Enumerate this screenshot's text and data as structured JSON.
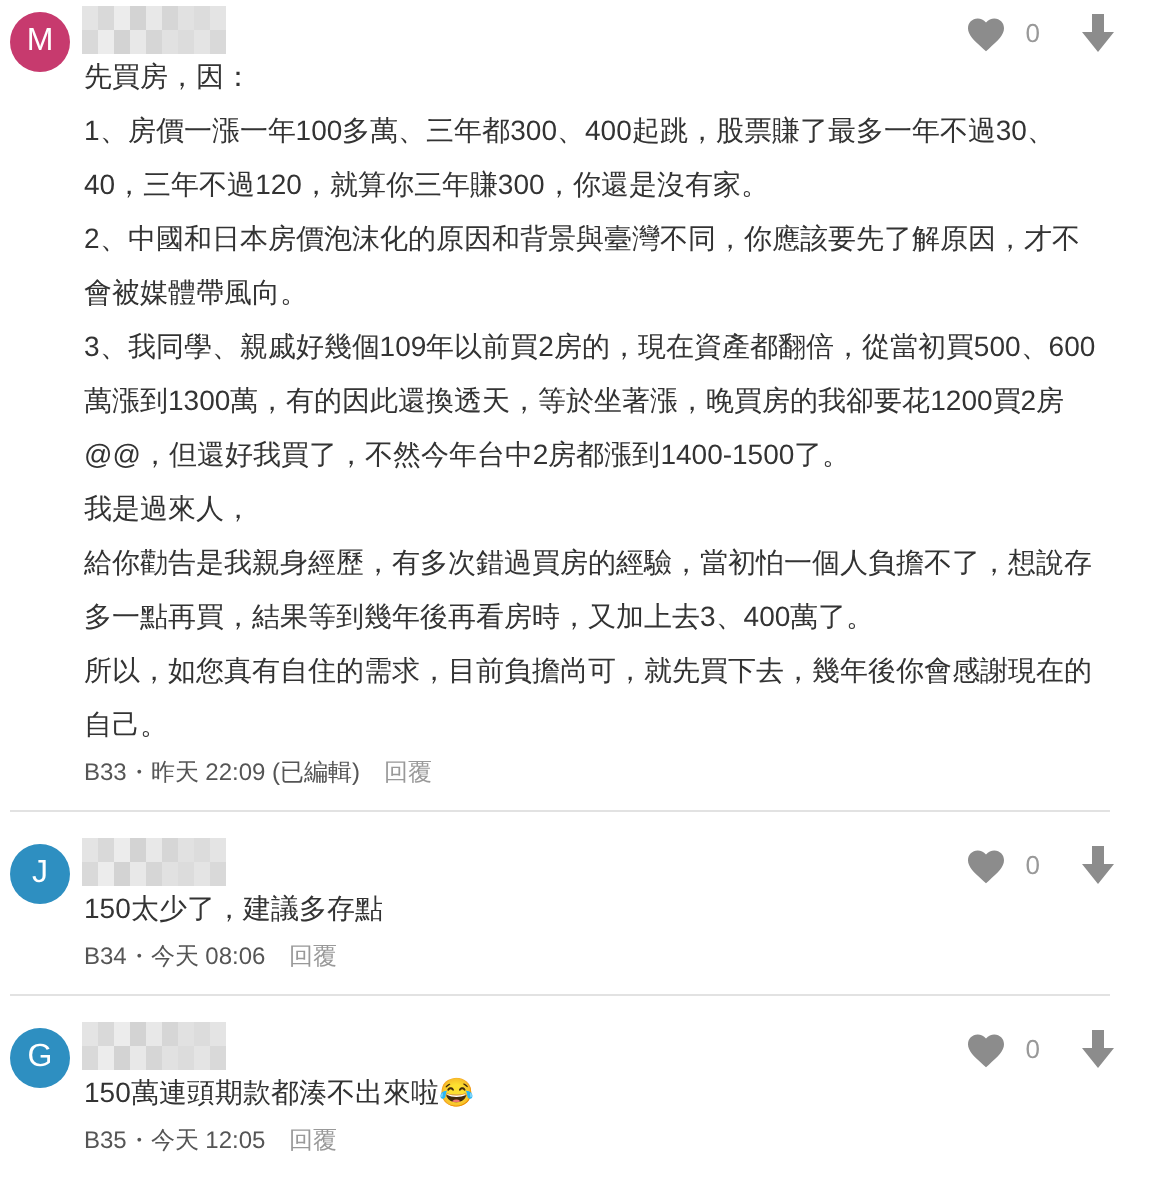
{
  "comments": [
    {
      "avatar": "M",
      "color": "#c73a6e",
      "likes": "0",
      "paragraphs": [
        "先買房，因：",
        "1、房價一漲一年100多萬、三年都300、400起跳，股票賺了最多一年不過30、40，三年不過120，就算你三年賺300，你還是沒有家。",
        "2、中國和日本房價泡沫化的原因和背景與臺灣不同，你應該要先了解原因，才不會被媒體帶風向。",
        "3、我同學、親戚好幾個109年以前買2房的，現在資產都翻倍，從當初買500、600萬漲到1300萬，有的因此還換透天，等於坐著漲，晚買房的我卻要花1200買2房@@，但還好我買了，不然今年台中2房都漲到1400-1500了。",
        "我是過來人，",
        "給你勸告是我親身經歷，有多次錯過買房的經驗，當初怕一個人負擔不了，想說存多一點再買，結果等到幾年後再看房時，又加上去3、400萬了。",
        "所以，如您真有自住的需求，目前負擔尚可，就先買下去，幾年後你會感謝現在的自己。"
      ],
      "meta": "B33・昨天 22:09 (已編輯)",
      "reply": "回覆"
    },
    {
      "avatar": "J",
      "color": "#2e8fc1",
      "likes": "0",
      "paragraphs": [
        "150太少了，建議多存點"
      ],
      "meta": "B34・今天 08:06",
      "reply": "回覆"
    },
    {
      "avatar": "G",
      "color": "#2e8fc1",
      "likes": "0",
      "paragraphs": [
        "150萬連頭期款都湊不出來啦😂"
      ],
      "meta": "B35・今天 12:05",
      "reply": "回覆"
    }
  ]
}
